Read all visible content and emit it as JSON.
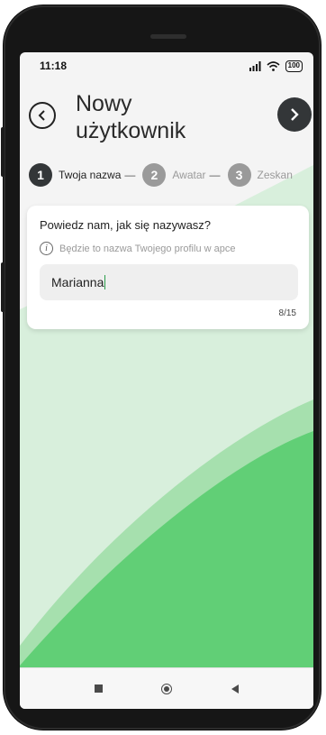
{
  "status_bar": {
    "time": "11:18",
    "signal_icon": "signal-icon",
    "wifi_icon": "wifi-icon",
    "battery": "100"
  },
  "header": {
    "title_line1": "Nowy",
    "title_line2": "użytkownik",
    "back_icon": "chevron-left-icon",
    "next_icon": "chevron-right-icon"
  },
  "steps": [
    {
      "number": "1",
      "label": "Twoja nazwa",
      "state": "active"
    },
    {
      "number": "2",
      "label": "Awatar",
      "state": "inactive"
    },
    {
      "number": "3",
      "label": "Zeskan",
      "state": "inactive"
    }
  ],
  "form": {
    "question": "Powiedz nam, jak się nazywasz?",
    "hint": "Będzie to nazwa Twojego profilu w apce",
    "name_value": "Marianna",
    "counter": "8/15"
  },
  "colors": {
    "dark_button": "#333638",
    "green_light": "#d8efdc",
    "green_mid": "#a6e0ae",
    "green_bright": "#61cf76",
    "caret": "#2a9d4a"
  },
  "nav_bar": {
    "recents_icon": "square-icon",
    "home_icon": "circle-home-icon",
    "back_icon": "triangle-back-icon"
  }
}
